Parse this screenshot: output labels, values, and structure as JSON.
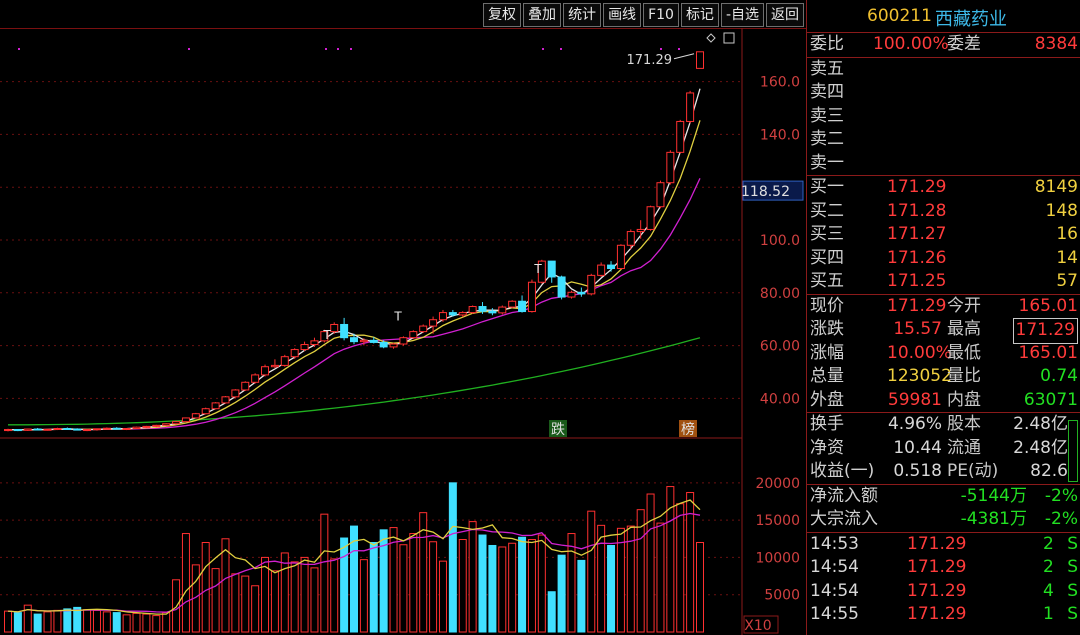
{
  "toolbar": {
    "buttons": [
      "复权",
      "叠加",
      "统计",
      "画线",
      "F10",
      "标记",
      "-自选",
      "返回"
    ]
  },
  "stock": {
    "code": "600211",
    "name": "西藏药业"
  },
  "ratio": {
    "label1": "委比",
    "value1": "100.00%",
    "label2": "委差",
    "value2": "8384"
  },
  "sell": [
    {
      "label": "卖五",
      "price": "",
      "qty": ""
    },
    {
      "label": "卖四",
      "price": "",
      "qty": ""
    },
    {
      "label": "卖三",
      "price": "",
      "qty": ""
    },
    {
      "label": "卖二",
      "price": "",
      "qty": ""
    },
    {
      "label": "卖一",
      "price": "",
      "qty": ""
    }
  ],
  "buy": [
    {
      "label": "买一",
      "price": "171.29",
      "qty": "8149"
    },
    {
      "label": "买二",
      "price": "171.28",
      "qty": "148"
    },
    {
      "label": "买三",
      "price": "171.27",
      "qty": "16"
    },
    {
      "label": "买四",
      "price": "171.26",
      "qty": "14"
    },
    {
      "label": "买五",
      "price": "171.25",
      "qty": "57"
    }
  ],
  "quote": [
    {
      "l1": "现价",
      "v1": "171.29",
      "l2": "今开",
      "v2": "165.01"
    },
    {
      "l1": "涨跌",
      "v1": "15.57",
      "l2": "最高",
      "v2": "171.29"
    },
    {
      "l1": "涨幅",
      "v1": "10.00%",
      "l2": "最低",
      "v2": "165.01"
    },
    {
      "l1": "总量",
      "v1": "123052",
      "l2": "量比",
      "v2": "0.74"
    },
    {
      "l1": "外盘",
      "v1": "59981",
      "l2": "内盘",
      "v2": "63071"
    }
  ],
  "fundamentals": [
    {
      "l1": "换手",
      "v1": "4.96%",
      "l2": "股本",
      "v2": "2.48亿"
    },
    {
      "l1": "净资",
      "v1": "10.44",
      "l2": "流通",
      "v2": "2.48亿"
    },
    {
      "l1": "收益(一)",
      "v1": "0.518",
      "l2": "PE(动)",
      "v2": "82.6"
    }
  ],
  "flows": [
    {
      "label": "净流入额",
      "value": "-5144万",
      "pct": "-2%"
    },
    {
      "label": "大宗流入",
      "value": "-4381万",
      "pct": "-2%"
    }
  ],
  "ticks": [
    {
      "time": "14:53",
      "price": "171.29",
      "vol": "2",
      "side": "S"
    },
    {
      "time": "14:54",
      "price": "171.29",
      "vol": "2",
      "side": "S"
    },
    {
      "time": "14:54",
      "price": "171.29",
      "vol": "4",
      "side": "S"
    },
    {
      "time": "14:55",
      "price": "171.29",
      "vol": "1",
      "side": "S"
    }
  ],
  "chart_data": {
    "type": "candlestick",
    "price_axis": {
      "ticks": [
        "160.0",
        "140.0",
        "120.0",
        "100.0",
        "80.00",
        "60.00",
        "40.00"
      ],
      "ylim": [
        25,
        175
      ]
    },
    "current_marker": "118.52",
    "high_annotation": "171.29",
    "volume_axis": {
      "ticks": [
        "20000",
        "15000",
        "10000",
        "5000"
      ],
      "unit": "X10",
      "ylim": [
        0,
        24000
      ]
    },
    "labels": {
      "drop": "跌",
      "board": "榜"
    },
    "candles": [
      [
        28,
        28.5,
        27.5,
        28.2
      ],
      [
        28.2,
        28.4,
        27.6,
        27.9
      ],
      [
        27.9,
        28.6,
        27.7,
        28.4
      ],
      [
        28.4,
        28.8,
        28.0,
        28.1
      ],
      [
        28.1,
        28.5,
        27.8,
        28.3
      ],
      [
        28.3,
        28.9,
        28.0,
        28.6
      ],
      [
        28.6,
        29.0,
        28.1,
        28.4
      ],
      [
        28.4,
        28.7,
        27.9,
        28.0
      ],
      [
        28.0,
        28.4,
        27.6,
        28.2
      ],
      [
        28.2,
        28.6,
        27.8,
        28.5
      ],
      [
        28.5,
        29.0,
        28.2,
        28.7
      ],
      [
        28.7,
        29.1,
        28.3,
        28.4
      ],
      [
        28.4,
        28.8,
        28.0,
        28.6
      ],
      [
        28.6,
        29.3,
        28.4,
        29.1
      ],
      [
        29.1,
        29.6,
        28.8,
        29.4
      ],
      [
        29.4,
        30.0,
        29.1,
        29.8
      ],
      [
        29.8,
        30.6,
        29.5,
        30.4
      ],
      [
        30.4,
        31.5,
        30.1,
        31.2
      ],
      [
        31.2,
        32.8,
        31.0,
        32.6
      ],
      [
        32.6,
        34.5,
        32.3,
        34.2
      ],
      [
        34.2,
        36.5,
        33.9,
        36.1
      ],
      [
        36.1,
        38.6,
        35.8,
        38.3
      ],
      [
        38.3,
        40.9,
        38.0,
        40.6
      ],
      [
        40.6,
        43.5,
        40.2,
        43.2
      ],
      [
        43.2,
        46.5,
        42.8,
        46.1
      ],
      [
        46.1,
        49.5,
        45.6,
        48.9
      ],
      [
        48.9,
        52.8,
        48.3,
        52.0
      ],
      [
        52.0,
        54.8,
        51.5,
        52.5
      ],
      [
        52.5,
        56.5,
        52.0,
        55.8
      ],
      [
        55.8,
        59.0,
        55.0,
        58.5
      ],
      [
        58.5,
        61.5,
        57.9,
        60.4
      ],
      [
        60.4,
        63.0,
        59.5,
        61.8
      ],
      [
        61.8,
        66.0,
        61.2,
        65.3
      ],
      [
        65.3,
        68.8,
        64.5,
        68.0
      ],
      [
        68.0,
        70.5,
        62.0,
        63.0
      ],
      [
        63.0,
        64.5,
        60.5,
        61.5
      ],
      [
        61.5,
        62.8,
        60.1,
        62.0
      ],
      [
        62.0,
        63.2,
        60.8,
        61.2
      ],
      [
        61.2,
        62.0,
        59.0,
        59.5
      ],
      [
        59.5,
        61.0,
        58.8,
        60.6
      ],
      [
        60.6,
        63.5,
        60.0,
        63.0
      ],
      [
        63.0,
        65.8,
        62.5,
        65.3
      ],
      [
        65.3,
        68.0,
        64.8,
        67.4
      ],
      [
        67.4,
        71.0,
        64.5,
        69.8
      ],
      [
        69.8,
        73.5,
        69.0,
        72.5
      ],
      [
        72.5,
        73.5,
        71.0,
        71.6
      ],
      [
        71.6,
        73.0,
        70.8,
        72.5
      ],
      [
        72.5,
        75.2,
        72.0,
        74.8
      ],
      [
        74.8,
        76.5,
        72.0,
        73.0
      ],
      [
        73.0,
        74.2,
        71.5,
        72.4
      ],
      [
        72.4,
        75.2,
        71.8,
        74.6
      ],
      [
        74.6,
        77.2,
        74.2,
        76.8
      ],
      [
        76.8,
        79.0,
        72.5,
        72.9
      ],
      [
        72.9,
        85.0,
        72.5,
        84.0
      ],
      [
        84.0,
        92.5,
        83.5,
        92.0
      ],
      [
        92.0,
        89.5,
        83.8,
        86.0
      ],
      [
        86.0,
        86.5,
        77.5,
        78.4
      ],
      [
        78.4,
        80.8,
        77.8,
        80.2
      ],
      [
        80.2,
        82.0,
        78.5,
        79.6
      ],
      [
        79.6,
        87.2,
        79.0,
        86.6
      ],
      [
        86.6,
        91.5,
        86.0,
        90.5
      ],
      [
        90.5,
        92.0,
        88.0,
        89.2
      ],
      [
        89.2,
        98.4,
        88.8,
        98.0
      ],
      [
        98.0,
        104.0,
        96.5,
        103.2
      ],
      [
        103.2,
        107.5,
        100.5,
        104.0
      ],
      [
        104.0,
        113.0,
        103.5,
        112.6
      ],
      [
        112.6,
        122.5,
        112.0,
        121.7
      ],
      [
        121.7,
        134.0,
        121.0,
        133.2
      ],
      [
        133.2,
        145.5,
        132.8,
        144.9
      ],
      [
        144.9,
        156.5,
        144.2,
        155.7
      ],
      [
        165.01,
        171.29,
        165.01,
        171.29
      ]
    ],
    "volumes": [
      2800,
      2600,
      3600,
      2400,
      2700,
      2900,
      3100,
      3300,
      3000,
      2900,
      2700,
      2600,
      2300,
      2500,
      2400,
      2200,
      2600,
      7000,
      13200,
      9000,
      12000,
      8500,
      12500,
      7800,
      7500,
      6200,
      10000,
      8200,
      10600,
      9400,
      10000,
      8600,
      15800,
      9800,
      12600,
      14200,
      9700,
      12000,
      13700,
      14000,
      11700,
      13200,
      16000,
      12100,
      9500,
      20000,
      12400,
      14800,
      13000,
      11600,
      11400,
      11900,
      12700,
      12400,
      13000,
      5400,
      10300,
      13200,
      9600,
      16200,
      14300,
      11600,
      13900,
      14200,
      16400,
      18500,
      14600,
      19500,
      17200,
      18700,
      12000
    ],
    "markers": [
      "T",
      "T",
      "T"
    ]
  }
}
